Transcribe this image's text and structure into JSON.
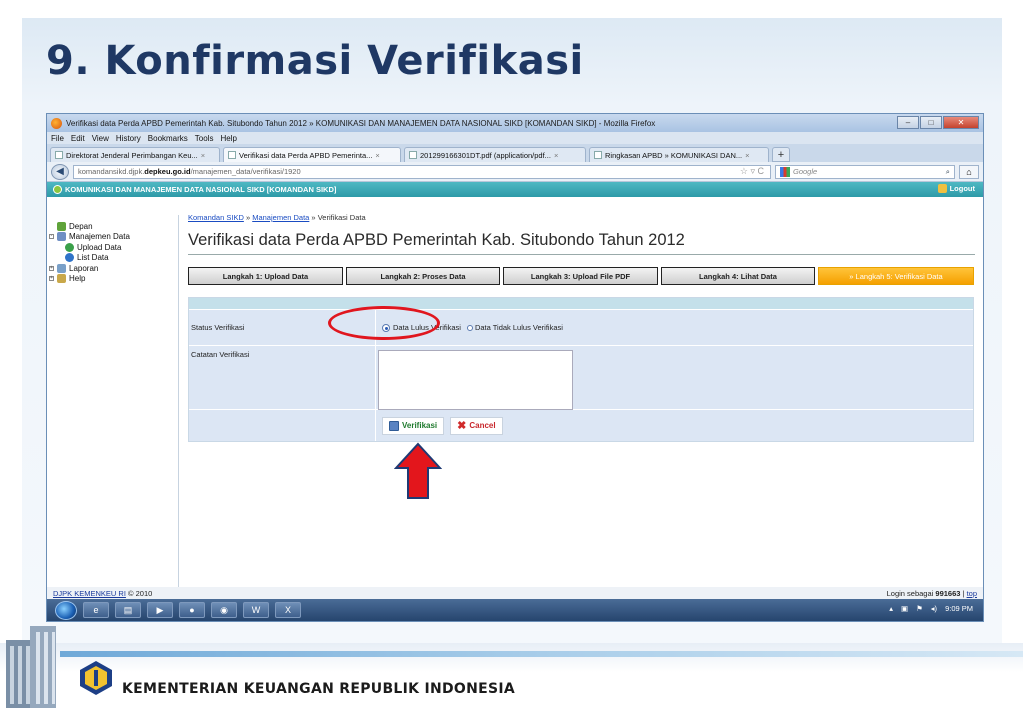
{
  "slide": {
    "title": "9. Konfirmasi Verifikasi",
    "ministry": "KEMENTERIAN KEUANGAN REPUBLIK INDONESIA"
  },
  "browser": {
    "window_title": "Verifikasi data Perda APBD Pemerintah Kab. Situbondo Tahun 2012 » KOMUNIKASI DAN MANAJEMEN DATA NASIONAL SIKD [KOMANDAN SIKD] - Mozilla Firefox",
    "menu": [
      "File",
      "Edit",
      "View",
      "History",
      "Bookmarks",
      "Tools",
      "Help"
    ],
    "tabs": [
      {
        "label": "Direktorat Jenderal Perimbangan Keu...",
        "active": false
      },
      {
        "label": "Verifikasi data Perda APBD Pemerinta...",
        "active": true
      },
      {
        "label": "201299166301DT.pdf (application/pdf...",
        "active": false
      },
      {
        "label": "Ringkasan APBD » KOMUNIKASI DAN...",
        "active": false
      }
    ],
    "url_prefix": "komandansikd.djpk.",
    "url_domain": "depkeu.go.id",
    "url_path": "/manajemen_data/verifikasi/1920",
    "search_placeholder": "Google"
  },
  "app": {
    "header": "KOMUNIKASI DAN MANAJEMEN DATA NASIONAL SIKD [KOMANDAN SIKD]",
    "logout": "Logout",
    "sidebar": [
      {
        "label": "Depan",
        "level": 0
      },
      {
        "label": "Manajemen Data",
        "level": 0
      },
      {
        "label": "Upload Data",
        "level": 1
      },
      {
        "label": "List Data",
        "level": 1
      },
      {
        "label": "Laporan",
        "level": 0
      },
      {
        "label": "Help",
        "level": 0
      }
    ],
    "breadcrumb": {
      "crumb1": "Komandan SIKD",
      "sep": " » ",
      "crumb2": "Manajemen Data",
      "current": "Verifikasi Data"
    },
    "page_title": "Verifikasi data Perda APBD Pemerintah Kab. Situbondo Tahun 2012",
    "steps": [
      {
        "label": "Langkah 1: Upload Data",
        "active": false
      },
      {
        "label": "Langkah 2: Proses Data",
        "active": false
      },
      {
        "label": "Langkah 3: Upload File PDF",
        "active": false
      },
      {
        "label": "Langkah 4: Lihat Data",
        "active": false
      },
      {
        "label": "» Langkah 5: Verifikasi Data",
        "active": true
      }
    ],
    "form": {
      "status_label": "Status Verifikasi",
      "option_pass": "Data Lulus Verifikasi",
      "option_fail": "Data Tidak Lulus Verifikasi",
      "selected": "pass",
      "note_label": "Catatan Verifikasi",
      "note_value": "",
      "verify_button": "Verifikasi",
      "cancel_button": "Cancel"
    },
    "footer_left": "DJPK KEMENKEU RI",
    "footer_copyright": " © 2010",
    "footer_login_prefix": "Login sebagai ",
    "footer_user": "991663",
    "footer_top": "top"
  },
  "taskbar": {
    "clock": "9:09 PM"
  }
}
